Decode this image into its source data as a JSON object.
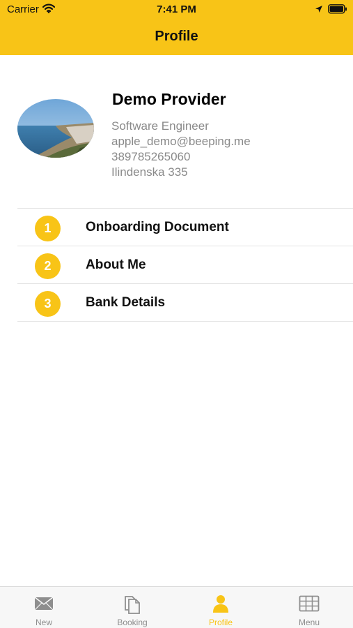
{
  "status_bar": {
    "carrier": "Carrier",
    "time": "7:41 PM",
    "icons": [
      "wifi-icon",
      "location-arrow-icon",
      "battery-icon"
    ]
  },
  "header": {
    "title": "Profile",
    "background_color": "#f8c417"
  },
  "profile": {
    "name": "Demo Provider",
    "job_title": "Software Engineer",
    "email": "apple_demo@beeping.me",
    "phone": "389785265060",
    "address": "Ilindenska 335",
    "avatar": "coastal-landscape-photo"
  },
  "menu": {
    "items": [
      {
        "number": "1",
        "label": "Onboarding Document"
      },
      {
        "number": "2",
        "label": "About Me"
      },
      {
        "number": "3",
        "label": "Bank Details"
      }
    ]
  },
  "tabbar": {
    "tabs": [
      {
        "label": "New",
        "icon": "envelope-icon",
        "active": false
      },
      {
        "label": "Booking",
        "icon": "documents-icon",
        "active": false
      },
      {
        "label": "Profile",
        "icon": "person-icon",
        "active": true
      },
      {
        "label": "Menu",
        "icon": "grid-icon",
        "active": false
      }
    ],
    "active_color": "#f8c417",
    "inactive_color": "#8e8e8e"
  }
}
